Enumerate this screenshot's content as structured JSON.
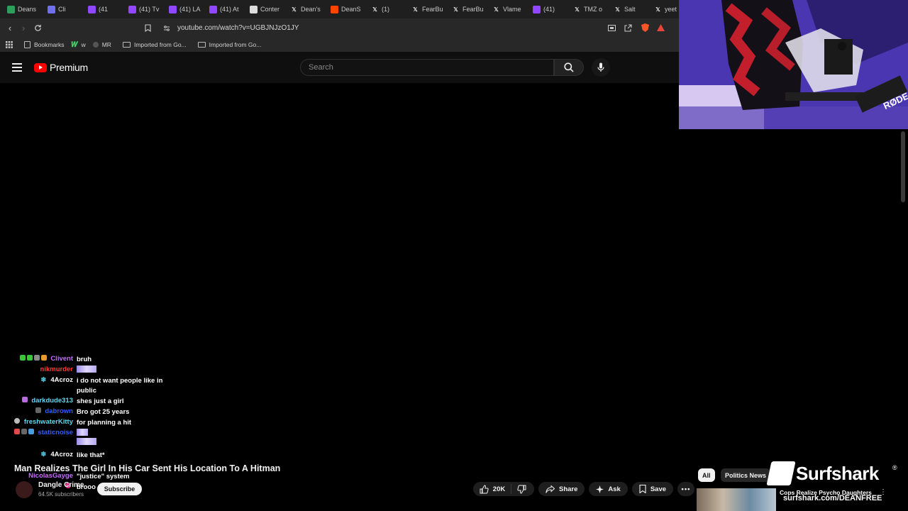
{
  "browser": {
    "tabs": [
      {
        "label": "Deans",
        "color": "#2e9e5b"
      },
      {
        "label": "Cli",
        "color": "#6f6ff0"
      },
      {
        "label": "(41",
        "color": "#9146ff"
      },
      {
        "label": "(41) Tv",
        "color": "#9146ff"
      },
      {
        "label": "(41) LA",
        "color": "#9146ff"
      },
      {
        "label": "(41) At",
        "color": "#9146ff"
      },
      {
        "label": "Conter",
        "color": "#dddddd"
      },
      {
        "label": "Dean's",
        "color": "#000000"
      },
      {
        "label": "DeanS",
        "color": "#ff4500"
      },
      {
        "label": "(1)",
        "color": "#000000"
      },
      {
        "label": "FearBu",
        "color": "#000000"
      },
      {
        "label": "FearBu",
        "color": "#000000"
      },
      {
        "label": "Vlame",
        "color": "#000000"
      },
      {
        "label": "(41)",
        "color": "#9146ff"
      },
      {
        "label": "TMZ o",
        "color": "#000000"
      },
      {
        "label": "Salt",
        "color": "#000000"
      },
      {
        "label": "yeet",
        "color": "#000000"
      }
    ],
    "url": "youtube.com/watch?v=UGBJNJzO1JY",
    "bookmarks": [
      {
        "label": "Bookmarks",
        "type": "bookmark"
      },
      {
        "label": "w",
        "type": "site"
      },
      {
        "label": "MR",
        "type": "site"
      },
      {
        "label": "Imported from Go...",
        "type": "folder"
      },
      {
        "label": "Imported from Go...",
        "type": "folder"
      }
    ]
  },
  "youtube": {
    "brand": "Premium",
    "search_placeholder": "Search"
  },
  "chat": [
    {
      "user": "Clivent",
      "user_color": "#c56cff",
      "message": "bruh"
    },
    {
      "user": "nikmurder",
      "user_color": "#ff3b30",
      "message": "",
      "emote": true
    },
    {
      "user": "4Acroz",
      "user_color": "#ffffff",
      "message": "i do not want people like in public"
    },
    {
      "user": "darkdude313",
      "user_color": "#5fd8f0",
      "message": "shes just a girl"
    },
    {
      "user": "dabrown",
      "user_color": "#2f5dff",
      "message": "Bro got 25 years"
    },
    {
      "user": "freshwaterKitty",
      "user_color": "#5fd8f0",
      "message": "for planning a hit"
    },
    {
      "user": "staticnoise",
      "user_color": "#2f5dff",
      "message": "",
      "emote": true
    },
    {
      "user": "4Acroz",
      "user_color": "#ffffff",
      "message": "like that*"
    },
    {
      "user": "NicolasGayge",
      "user_color": "#c56cff",
      "message": "\"justice\" system"
    },
    {
      "user": "",
      "user_color": "#ffffff",
      "message": "brooo"
    }
  ],
  "video": {
    "title": "Man Realizes The Girl In His Car Sent His Location To A Hitman",
    "channel": "Dangle Crime",
    "subscribers": "64.5K subscribers",
    "subscribe_label": "Subscribe",
    "likes": "20K",
    "share_label": "Share",
    "ask_label": "Ask",
    "save_label": "Save"
  },
  "sidebar": {
    "chips": [
      "All",
      "Politics News"
    ],
    "recommended_title": "Cops Realize Psycho Daughters"
  },
  "sponsor": {
    "name": "Surfshark",
    "url": "surfshark.com/DEANFREE"
  }
}
